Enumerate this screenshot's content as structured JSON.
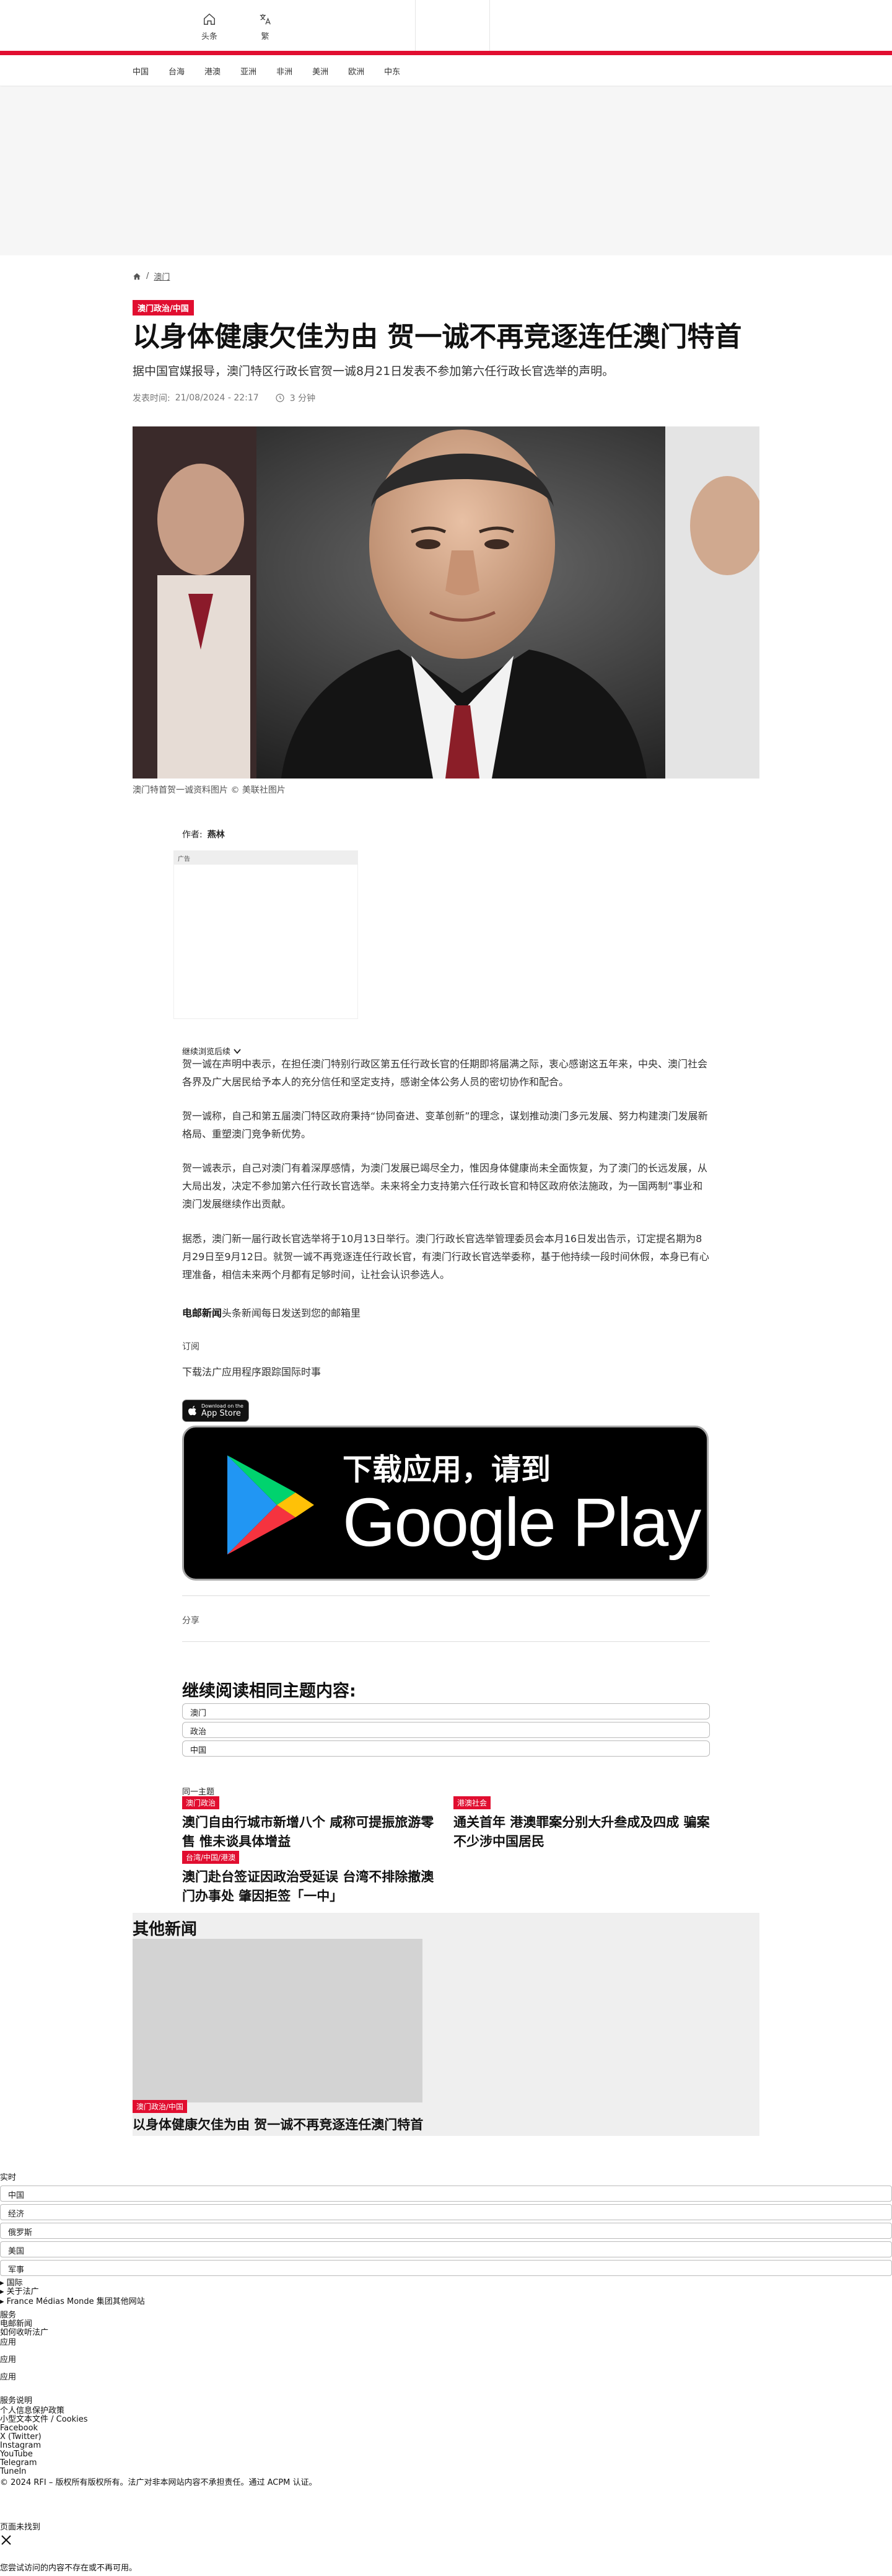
{
  "header": {
    "tabs": [
      {
        "label": "头条"
      },
      {
        "label": "繁"
      }
    ],
    "nav": [
      "中国",
      "台海",
      "港澳",
      "亚洲",
      "非洲",
      "美洲",
      "欧洲",
      "中东"
    ]
  },
  "breadcrumb": {
    "current": "澳门"
  },
  "article": {
    "category": "澳门政治/中国",
    "title": "以身体健康欠佳为由 贺一诚不再竞逐连任澳门特首",
    "lede": "据中国官媒报导，澳门特区行政长官贺一诚8月21日发表不参加第六任行政长官选举的声明。",
    "published_label": "发表时间:",
    "published": "21/08/2024 - 22:17",
    "read_time": "3 分钟",
    "caption": "澳门特首贺一诚资料图片 © 美联社图片",
    "author_label": "作者:",
    "author": "燕林",
    "ad_label": "广告",
    "continue_reading": "继续浏览后续",
    "paragraphs": [
      "贺一诚在声明中表示，在担任澳门特别行政区第五任行政长官的任期即将届满之际，衷心感谢这五年来，中央、澳门社会各界及广大居民给予本人的充分信任和坚定支持，感谢全体公务人员的密切协作和配合。",
      "贺一诚称，自己和第五届澳门特区政府秉持“协同奋进、变革创新”的理念，谋划推动澳门多元发展、努力构建澳门发展新格局、重塑澳门竞争新优势。",
      "贺一诚表示，自己对澳门有着深厚感情，为澳门发展已竭尽全力，惟因身体健康尚未全面恢复，为了澳门的长远发展，从大局出发，决定不参加第六任行政长官选举。未来将全力支持第六任行政长官和特区政府依法施政，为一国两制”事业和澳门发展继续作出贡献。",
      "据悉，澳门新一届行政长官选举将于10月13日举行。澳门行政长官选举管理委员会本月16日发出告示，订定提名期为8月29日至9月12日。就贺一诚不再竞逐连任行政长官，有澳门行政长官选举委称，基于他持续一段时间休假，本身已有心理准备，相信未来两个月都有足够时间，让社会认识参选人。"
    ],
    "newsletter_bold": "电邮新闻",
    "newsletter_text": "头条新闻每日发送到您的邮箱里"
  },
  "app": {
    "subscribe": "订阅",
    "download_text": "下载法广应用程序跟踪国际时事",
    "appstore_small": "Download on the",
    "appstore_large": "App Store",
    "gplay_line1": "下载应用，请到",
    "gplay_line2": "Google Play"
  },
  "share_label": "分享",
  "related": {
    "title": "继续阅读相同主题内容:",
    "topics": [
      "澳门",
      "政治",
      "中国"
    ],
    "same_topic_label": "同一主题",
    "items": [
      {
        "tag": "澳门政治",
        "title": "澳门自由行城市新增八个 咸称可提振旅游零售 惟未谈具体增益"
      },
      {
        "tag": "港澳社会",
        "title": "通关首年 港澳罪案分别大升叁成及四成 骗案不少涉中国居民"
      },
      {
        "tag": "台湾/中国/港澳",
        "title": "澳门赴台签证因政治受延误 台湾不排除撤澳门办事处 肇因拒签「一中」"
      }
    ]
  },
  "other_news": {
    "title": "其他新闻",
    "tag": "澳门政治/中国",
    "headline": "以身体健康欠佳为由 贺一诚不再竞逐连任澳门特首"
  },
  "footer": {
    "realtime": "实时",
    "topics": [
      "中国",
      "经济",
      "俄罗斯",
      "美国",
      "军事"
    ],
    "sections": [
      "国际",
      "关于法广",
      "France Médias Monde 集团其他网站"
    ],
    "services_label": "服务",
    "services": [
      "电邮新闻",
      "如何收听法广"
    ],
    "apps": [
      "应用",
      "应用",
      "应用"
    ],
    "legal": [
      "服务说明",
      "个人信息保护政策",
      "小型文本文件 / Cookies"
    ],
    "social": [
      "Facebook",
      "X (Twitter)",
      "Instagram",
      "YouTube",
      "Telegram",
      "TuneIn"
    ],
    "copyright": "© 2024 RFI – 版权所有版权所有。法广对非本网站内容不承担责任。通过 ACPM 认证。",
    "notfound_title": "页面未找到",
    "notfound_text": "您尝试访问的内容不存在或不再可用。"
  }
}
